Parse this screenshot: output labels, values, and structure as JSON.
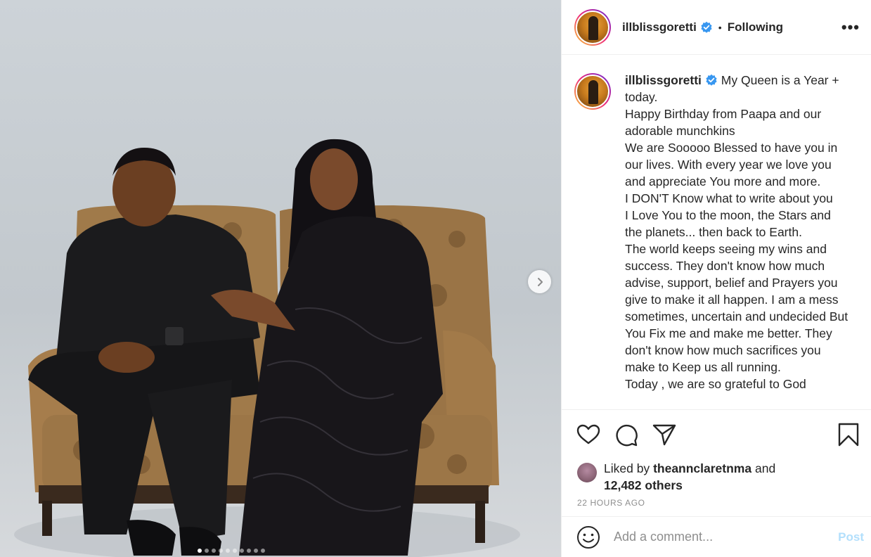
{
  "post": {
    "username": "illblissgoretti",
    "verified": true,
    "follow_separator": "•",
    "follow_status": "Following",
    "more_label": "•••",
    "caption_lines": [
      "My Queen is a Year +",
      "today.",
      "Happy Birthday from Paapa and our",
      "adorable munchkins",
      "We are Sooooo Blessed to have you in",
      "our lives. With every year we love you",
      "and appreciate You more and more.",
      "I DON'T Know what to write about you",
      "I Love You to the moon, the Stars and",
      "the planets... then back to Earth.",
      "The world keeps seeing my wins and",
      "success. They don't know how much",
      "advise, support, belief and Prayers you",
      "give to make it all happen. I am a mess",
      "sometimes, uncertain and undecided But",
      "You Fix me and make me better. They",
      "don't know how much sacrifices you",
      "make to Keep us all running.",
      "Today , we are so grateful to God"
    ],
    "likes": {
      "prefix": "Liked by",
      "liker": "theannclaretnma",
      "joiner": "and",
      "others": "12,482 others"
    },
    "timestamp": "22 HOURS AGO",
    "comment_placeholder": "Add a comment...",
    "post_label": "Post",
    "carousel": {
      "total": 10,
      "active": 1
    }
  },
  "icons": {
    "verified": "verified-badge-icon",
    "like": "heart-icon",
    "comment": "comment-bubble-icon",
    "share": "paper-plane-icon",
    "save": "bookmark-icon",
    "emoji": "smiley-icon",
    "next": "chevron-right-icon"
  },
  "colors": {
    "verified_blue": "#3897f0",
    "post_button": "#b2dffc",
    "muted_text": "#8e8e8e",
    "story_ring": "#ee2a7b"
  }
}
